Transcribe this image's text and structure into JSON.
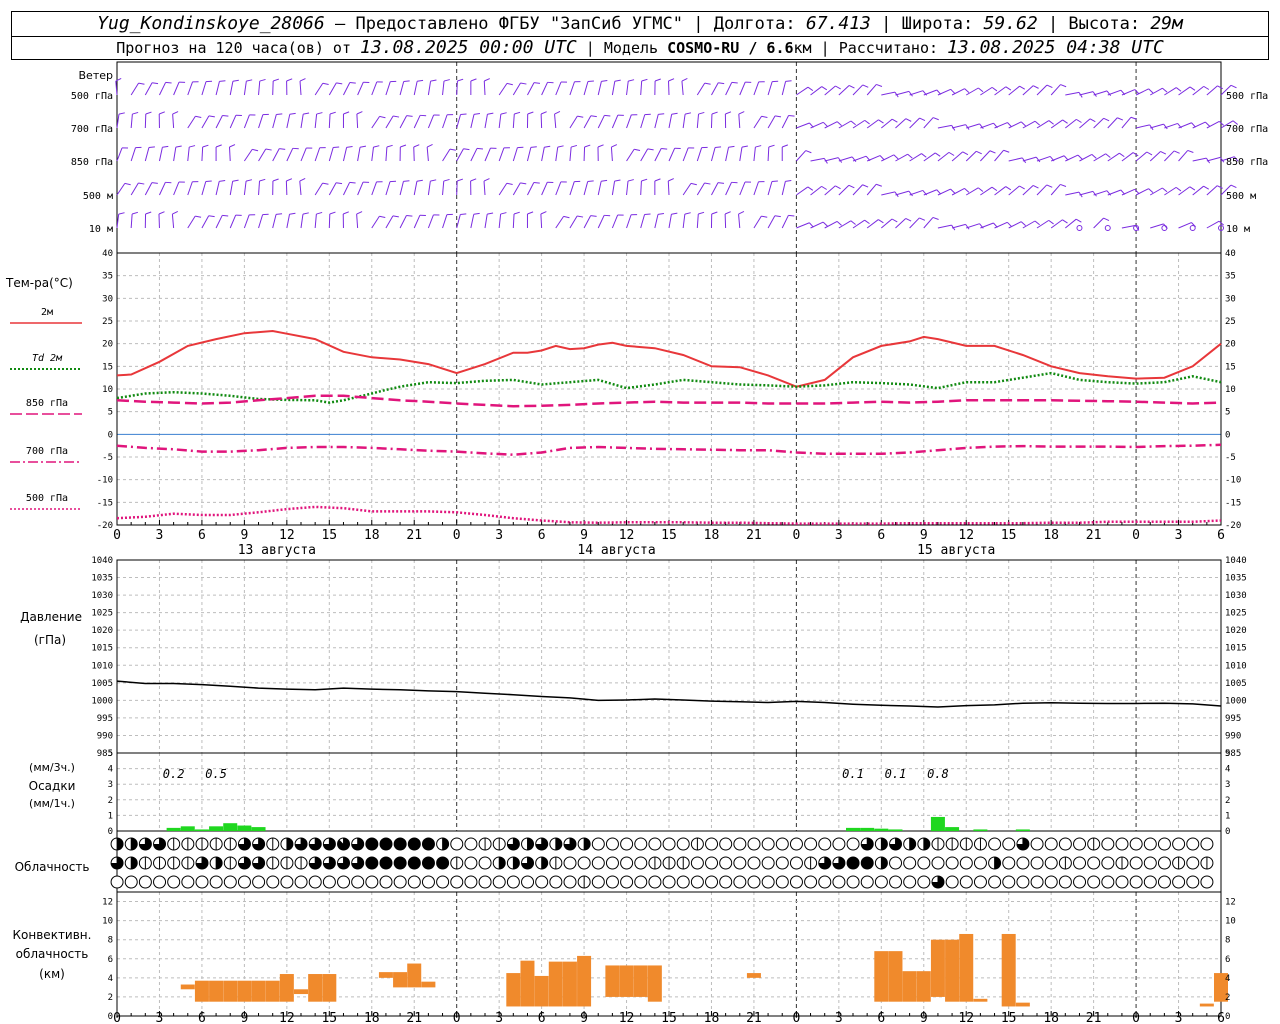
{
  "header": {
    "station": "Yug_Kondinskoye_28066",
    "dash": "–",
    "provided": "Предоставлено ФГБУ \"ЗапСиб УГМС\"",
    "lon_label": "Долгота:",
    "lon": "67.413",
    "lat_label": "Широта:",
    "lat": "59.62",
    "alt_label": "Высота:",
    "alt": "29м",
    "forecast_label": "Прогноз на 120 часа(ов) от",
    "forecast_start": "13.08.2025 00:00 UTC",
    "model_label": "Модель",
    "model": "COSMO-RU / 6.6",
    "model_unit": "км",
    "calc_label": "Рассчитано:",
    "calc_time": "13.08.2025 04:38 UTC"
  },
  "colors": {
    "wind": "#7a2be0",
    "t2m": "#e8373a",
    "td": "#118a11",
    "t_levels": "#e0157c",
    "precip": "#1fd71f",
    "conv": "#f08a2c",
    "grid": "#bdbdbd"
  },
  "wind_panel": {
    "title": "Ветер",
    "levels": [
      "500 гПа",
      "700 гПа",
      "850 гПа",
      "500 м",
      "10 м"
    ]
  },
  "temp_panel": {
    "title": "Тем-ра(°C)",
    "legend": [
      {
        "label": "2м",
        "style": "solid",
        "color": "#e8373a"
      },
      {
        "label": "Td  2м",
        "style": "dotted",
        "color": "#118a11"
      },
      {
        "label": "850 гПа",
        "style": "long-dash",
        "color": "#e0157c"
      },
      {
        "label": "700 гПа",
        "style": "dash-dot",
        "color": "#e0157c"
      },
      {
        "label": "500 гПа",
        "style": "dotted",
        "color": "#e0157c"
      }
    ],
    "y_ticks": [
      "40",
      "35",
      "30",
      "25",
      "20",
      "15",
      "10",
      "5",
      "0",
      "-5",
      "-10",
      "-15",
      "-20"
    ]
  },
  "time_axis": {
    "hour_labels": [
      "0",
      "3",
      "6",
      "9",
      "12",
      "15",
      "18",
      "21",
      "0",
      "3",
      "6",
      "9",
      "12",
      "15",
      "18",
      "21",
      "0",
      "3",
      "6",
      "9",
      "12",
      "15",
      "18",
      "21",
      "0",
      "3",
      "6"
    ],
    "days": [
      "13 августа",
      "14 августа",
      "15 августа"
    ]
  },
  "pressure_panel": {
    "title_line1": "Давление",
    "title_line2": "(гПа)",
    "y_ticks": [
      "1040",
      "1035",
      "1030",
      "1025",
      "1020",
      "1015",
      "1010",
      "1005",
      "1000",
      "995",
      "990",
      "985"
    ]
  },
  "precip_panel": {
    "label_3h": "(мм/3ч.)",
    "title": "Осадки",
    "label_1h": "(мм/1ч.)",
    "y_ticks": [
      "5",
      "4",
      "3",
      "2",
      "1",
      "0"
    ],
    "amounts": [
      {
        "hour": 4,
        "text": "0.2"
      },
      {
        "hour": 7,
        "text": "0.5"
      },
      {
        "hour": 52,
        "text": "0.1"
      },
      {
        "hour": 55,
        "text": "0.1"
      },
      {
        "hour": 58,
        "text": "0.8"
      }
    ]
  },
  "cloud_panel": {
    "title": "Облачность"
  },
  "conv_panel": {
    "title_line1": "Конвективн.",
    "title_line2": "облачность",
    "title_line3": "(км)",
    "y_ticks": [
      "12",
      "10",
      "8",
      "6",
      "4",
      "2",
      "0"
    ]
  },
  "chart_data": {
    "type": "line",
    "x_unit": "hours since 13.08.2025 00:00 UTC",
    "x_range": [
      0,
      78
    ],
    "series": [
      {
        "name": "2м",
        "unit": "°C",
        "x": [
          0,
          1,
          3,
          5,
          7,
          9,
          11,
          12,
          14,
          16,
          18,
          20,
          22,
          24,
          26,
          28,
          29,
          30,
          31,
          32,
          33,
          34,
          35,
          36,
          38,
          40,
          42,
          44,
          46,
          48,
          50,
          52,
          54,
          56,
          57,
          58,
          60,
          62,
          64,
          66,
          68,
          70,
          72,
          74,
          76,
          78
        ],
        "y": [
          13,
          13.2,
          16,
          19.5,
          21,
          22.3,
          22.8,
          22.2,
          21,
          18.2,
          17,
          16.5,
          15.5,
          13.5,
          15.5,
          18,
          18,
          18.5,
          19.5,
          18.8,
          19,
          19.8,
          20.2,
          19.5,
          19,
          17.5,
          15,
          14.8,
          13,
          10.5,
          12,
          17,
          19.5,
          20.5,
          21.5,
          21,
          19.5,
          19.5,
          17.5,
          15,
          13.5,
          12.8,
          12.3,
          12.5,
          15,
          20
        ]
      },
      {
        "name": "Td  2м",
        "unit": "°C",
        "x": [
          0,
          1,
          2,
          4,
          6,
          8,
          10,
          12,
          14,
          15,
          16,
          18,
          19,
          20,
          22,
          24,
          26,
          28,
          30,
          32,
          34,
          36,
          38,
          40,
          42,
          44,
          46,
          48,
          50,
          52,
          54,
          56,
          58,
          60,
          62,
          64,
          66,
          68,
          70,
          72,
          74,
          76,
          78
        ],
        "y": [
          8,
          8.5,
          9,
          9.3,
          9,
          8.5,
          7.8,
          7.6,
          7.5,
          7,
          7.5,
          9,
          9.8,
          10.5,
          11.5,
          11.3,
          11.8,
          12,
          11,
          11.5,
          12,
          10.2,
          11,
          12,
          11.5,
          11,
          10.8,
          10.5,
          10.8,
          11.5,
          11.3,
          11,
          10.2,
          11.5,
          11.5,
          12.5,
          13.5,
          12,
          11.5,
          11.2,
          11.5,
          12.8,
          11.5
        ]
      },
      {
        "name": "850 гПа",
        "unit": "°C",
        "x": [
          0,
          2,
          4,
          6,
          8,
          10,
          12,
          14,
          16,
          18,
          20,
          22,
          24,
          26,
          28,
          30,
          32,
          34,
          36,
          38,
          40,
          42,
          44,
          46,
          48,
          50,
          52,
          54,
          56,
          58,
          60,
          62,
          64,
          66,
          68,
          70,
          72,
          74,
          76,
          78
        ],
        "y": [
          7.5,
          7.2,
          7,
          6.8,
          7,
          7.5,
          8,
          8.5,
          8.5,
          8,
          7.5,
          7.2,
          6.8,
          6.5,
          6.2,
          6.3,
          6.5,
          6.8,
          7,
          7.2,
          7,
          7,
          7,
          6.8,
          6.8,
          6.8,
          7,
          7.2,
          7,
          7.2,
          7.5,
          7.5,
          7.5,
          7.5,
          7.4,
          7.3,
          7.2,
          7,
          6.8,
          7
        ]
      },
      {
        "name": "700 гПа",
        "unit": "°C",
        "x": [
          0,
          2,
          4,
          6,
          8,
          10,
          12,
          14,
          16,
          18,
          20,
          22,
          24,
          26,
          28,
          30,
          32,
          34,
          36,
          38,
          40,
          42,
          44,
          46,
          48,
          50,
          52,
          54,
          56,
          58,
          60,
          62,
          64,
          66,
          68,
          70,
          72,
          74,
          76,
          78
        ],
        "y": [
          -2.5,
          -3,
          -3.3,
          -3.8,
          -3.8,
          -3.5,
          -3,
          -2.8,
          -2.8,
          -3,
          -3.3,
          -3.6,
          -3.8,
          -4.2,
          -4.5,
          -4,
          -3,
          -2.8,
          -3,
          -3.2,
          -3.3,
          -3.4,
          -3.5,
          -3.5,
          -4,
          -4.3,
          -4.3,
          -4.3,
          -4,
          -3.5,
          -3,
          -2.7,
          -2.6,
          -2.7,
          -2.7,
          -2.7,
          -2.8,
          -2.6,
          -2.5,
          -2.3
        ]
      },
      {
        "name": "500 гПа",
        "unit": "°C",
        "x": [
          0,
          2,
          4,
          6,
          8,
          10,
          12,
          14,
          16,
          18,
          20,
          22,
          24,
          26,
          28,
          30,
          32,
          34,
          36,
          38,
          40,
          42,
          44,
          46,
          48,
          50,
          52,
          54,
          56,
          58,
          60,
          62,
          64,
          66,
          68,
          70,
          72,
          74,
          76,
          78
        ],
        "y": [
          -18.5,
          -18.2,
          -17.5,
          -17.8,
          -17.8,
          -17.2,
          -16.5,
          -16,
          -16.3,
          -17,
          -17,
          -17,
          -17.2,
          -17.8,
          -18.5,
          -19,
          -19.4,
          -19.5,
          -19.4,
          -19.4,
          -19.4,
          -19.5,
          -19.5,
          -19.6,
          -19.7,
          -19.7,
          -19.7,
          -19.7,
          -19.6,
          -19.6,
          -19.6,
          -19.6,
          -19.6,
          -19.5,
          -19.5,
          -19.3,
          -19.3,
          -19.3,
          -19.3,
          -19
        ]
      },
      {
        "name": "Давление",
        "unit": "гПа",
        "x": [
          0,
          2,
          4,
          6,
          8,
          10,
          12,
          14,
          16,
          18,
          20,
          22,
          24,
          26,
          28,
          30,
          32,
          34,
          36,
          38,
          40,
          42,
          44,
          46,
          48,
          50,
          52,
          54,
          56,
          58,
          60,
          62,
          64,
          66,
          68,
          70,
          72,
          74,
          76,
          78
        ],
        "y": [
          1005.5,
          1004.8,
          1004.8,
          1004.5,
          1004,
          1003.5,
          1003.2,
          1003,
          1003.5,
          1003.2,
          1003,
          1002.7,
          1002.5,
          1002,
          1001.6,
          1001.1,
          1000.7,
          1000,
          1000.1,
          1000.4,
          1000.1,
          999.8,
          999.6,
          999.4,
          999.7,
          999.4,
          998.9,
          998.6,
          998.4,
          998.1,
          998.5,
          998.7,
          999.2,
          999.3,
          999.2,
          999.1,
          999.1,
          999.2,
          999,
          998.4
        ]
      }
    ],
    "temp_ylim": [
      -20,
      40
    ],
    "pressure_ylim": [
      985,
      1040
    ],
    "precip_1h_mm": [
      [
        4,
        0.2
      ],
      [
        5,
        0.3
      ],
      [
        6,
        0.1
      ],
      [
        7,
        0.3
      ],
      [
        8,
        0.5
      ],
      [
        9,
        0.35
      ],
      [
        10,
        0.25
      ],
      [
        52,
        0.2
      ],
      [
        53,
        0.2
      ],
      [
        54,
        0.15
      ],
      [
        55,
        0.1
      ],
      [
        58,
        0.9
      ],
      [
        59,
        0.25
      ],
      [
        61,
        0.1
      ],
      [
        64,
        0.1
      ]
    ],
    "precip_ylim": [
      0,
      5
    ],
    "convective_cloud_km": [
      {
        "hour": 5,
        "base": 2.8,
        "top": 3.3
      },
      {
        "hour": 6,
        "base": 1.5,
        "top": 3.7
      },
      {
        "hour": 7,
        "base": 1.5,
        "top": 3.7
      },
      {
        "hour": 8,
        "base": 1.5,
        "top": 3.7
      },
      {
        "hour": 9,
        "base": 1.5,
        "top": 3.7
      },
      {
        "hour": 10,
        "base": 1.5,
        "top": 3.7
      },
      {
        "hour": 11,
        "base": 1.5,
        "top": 3.7
      },
      {
        "hour": 12,
        "base": 1.5,
        "top": 4.4
      },
      {
        "hour": 13,
        "base": 2.3,
        "top": 2.8
      },
      {
        "hour": 14,
        "base": 1.5,
        "top": 4.4
      },
      {
        "hour": 15,
        "base": 1.5,
        "top": 4.4
      },
      {
        "hour": 19,
        "base": 4.0,
        "top": 4.6
      },
      {
        "hour": 20,
        "base": 3.0,
        "top": 4.6
      },
      {
        "hour": 21,
        "base": 3.0,
        "top": 5.5
      },
      {
        "hour": 22,
        "base": 3.0,
        "top": 3.6
      },
      {
        "hour": 28,
        "base": 1.0,
        "top": 4.5
      },
      {
        "hour": 29,
        "base": 1.0,
        "top": 5.8
      },
      {
        "hour": 30,
        "base": 1.0,
        "top": 4.2
      },
      {
        "hour": 31,
        "base": 1.0,
        "top": 5.7
      },
      {
        "hour": 32,
        "base": 1.0,
        "top": 5.7
      },
      {
        "hour": 33,
        "base": 1.0,
        "top": 6.3
      },
      {
        "hour": 35,
        "base": 2.0,
        "top": 5.3
      },
      {
        "hour": 36,
        "base": 2.0,
        "top": 5.3
      },
      {
        "hour": 37,
        "base": 2.0,
        "top": 5.3
      },
      {
        "hour": 38,
        "base": 1.5,
        "top": 5.3
      },
      {
        "hour": 45,
        "base": 4.0,
        "top": 4.5
      },
      {
        "hour": 54,
        "base": 1.5,
        "top": 6.8
      },
      {
        "hour": 55,
        "base": 1.5,
        "top": 6.8
      },
      {
        "hour": 56,
        "base": 1.5,
        "top": 4.7
      },
      {
        "hour": 57,
        "base": 1.5,
        "top": 4.7
      },
      {
        "hour": 58,
        "base": 2.0,
        "top": 8.0
      },
      {
        "hour": 59,
        "base": 1.5,
        "top": 8.0
      },
      {
        "hour": 60,
        "base": 1.5,
        "top": 8.6
      },
      {
        "hour": 61,
        "base": 1.5,
        "top": 1.8
      },
      {
        "hour": 63,
        "base": 1.0,
        "top": 8.6
      },
      {
        "hour": 64,
        "base": 1.0,
        "top": 1.4
      },
      {
        "hour": 77,
        "base": 1.0,
        "top": 1.3
      },
      {
        "hour": 78,
        "base": 1.5,
        "top": 4.5
      }
    ],
    "conv_ylim": [
      0,
      13
    ],
    "cloud_cover_eighths": {
      "high": [
        4,
        4,
        6,
        6,
        2,
        2,
        2,
        2,
        2,
        6,
        6,
        2,
        4,
        6,
        6,
        6,
        7,
        6,
        8,
        8,
        8,
        8,
        8,
        4,
        0,
        0,
        2,
        2,
        6,
        4,
        6,
        4,
        6,
        4,
        0,
        0,
        0,
        0,
        0,
        0,
        0,
        2,
        0,
        0,
        0,
        0,
        0,
        0,
        0,
        0,
        0,
        0,
        0,
        6,
        4,
        6,
        4,
        4,
        2,
        2,
        2,
        2,
        0,
        0,
        6,
        0,
        0,
        0,
        0,
        2,
        0,
        0,
        0,
        0,
        0,
        0,
        0,
        0
      ],
      "middle": [
        6,
        4,
        2,
        2,
        2,
        2,
        6,
        4,
        2,
        6,
        6,
        2,
        2,
        2,
        6,
        6,
        6,
        6,
        8,
        8,
        8,
        8,
        8,
        8,
        2,
        0,
        0,
        4,
        4,
        6,
        4,
        2,
        0,
        0,
        0,
        0,
        0,
        0,
        2,
        2,
        2,
        0,
        0,
        0,
        0,
        0,
        0,
        0,
        0,
        2,
        6,
        6,
        8,
        8,
        4,
        0,
        0,
        0,
        0,
        0,
        0,
        0,
        4,
        0,
        0,
        0,
        0,
        2,
        0,
        0,
        0,
        2,
        0,
        0,
        0,
        2,
        0,
        2
      ],
      "low": [
        0,
        0,
        0,
        0,
        0,
        0,
        0,
        0,
        0,
        0,
        0,
        0,
        0,
        0,
        0,
        0,
        0,
        0,
        0,
        0,
        0,
        0,
        0,
        0,
        0,
        0,
        0,
        0,
        0,
        0,
        0,
        0,
        0,
        2,
        0,
        0,
        0,
        0,
        0,
        0,
        0,
        0,
        0,
        0,
        0,
        0,
        0,
        0,
        0,
        0,
        0,
        0,
        0,
        0,
        0,
        0,
        0,
        0,
        6,
        0,
        0,
        0,
        0,
        0,
        0,
        0,
        0,
        0,
        0,
        0,
        0,
        0,
        0,
        0,
        0,
        0,
        0,
        0
      ]
    }
  }
}
